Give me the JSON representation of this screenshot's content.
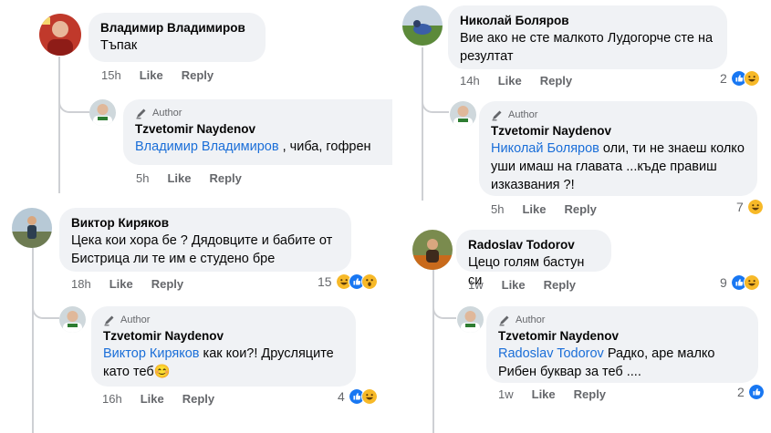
{
  "labels": {
    "author": "Author",
    "like": "Like",
    "reply": "Reply"
  },
  "left": {
    "c1": {
      "name": "Владимир Владимиров",
      "text": "Тъпак",
      "time": "15h"
    },
    "r1": {
      "name": "Tzvetomir Naydenov",
      "mention": "Владимир Владимиров",
      "text": " , чиба, гофрен",
      "time": "5h"
    },
    "c2": {
      "name": "Виктор Киряков",
      "text": "Цека кои хора бе ? Дядовците и бабите от Бистрица ли те им е студено бре",
      "time": "18h",
      "reactions_count": "15",
      "reactions": [
        "haha-icon",
        "like-icon",
        "wow-icon"
      ]
    },
    "r2": {
      "name": "Tzvetomir Naydenov",
      "mention": "Виктор Киряков",
      "text": " как кои?! Друсляците като теб😊",
      "time": "16h",
      "reactions_count": "4",
      "reactions": [
        "like-icon",
        "haha-icon"
      ]
    }
  },
  "right": {
    "c1": {
      "name": "Николай Боляров",
      "text": "Вие ако не сте малкото Лудогорче сте на резултат",
      "time": "14h",
      "reactions_count": "2",
      "reactions": [
        "like-icon",
        "haha-icon"
      ]
    },
    "r1": {
      "name": "Tzvetomir Naydenov",
      "mention": "Николай Боляров",
      "text": " оли, ти не знаеш колко уши имаш на главата ...къде правиш изказвания ?!",
      "time": "5h",
      "reactions_count": "7",
      "reactions": [
        "haha-icon"
      ]
    },
    "c2": {
      "name": "Radoslav Todorov",
      "text": "Цецо голям бастун си",
      "time": "1w",
      "reactions_count": "9",
      "reactions": [
        "like-icon",
        "haha-icon"
      ]
    },
    "r2": {
      "name": "Tzvetomir Naydenov",
      "mention": "Radoslav Todorov",
      "text": " Радко, аре малко Рибен буквар за теб ....",
      "time": "1w",
      "reactions_count": "2",
      "reactions": [
        "like-icon"
      ]
    }
  },
  "colors": {
    "mention": "#1a6ed8",
    "like_blue": "#1877f2",
    "haha_yellow": "#f7b928",
    "bubble": "#f0f2f5",
    "meta": "#65676b"
  }
}
